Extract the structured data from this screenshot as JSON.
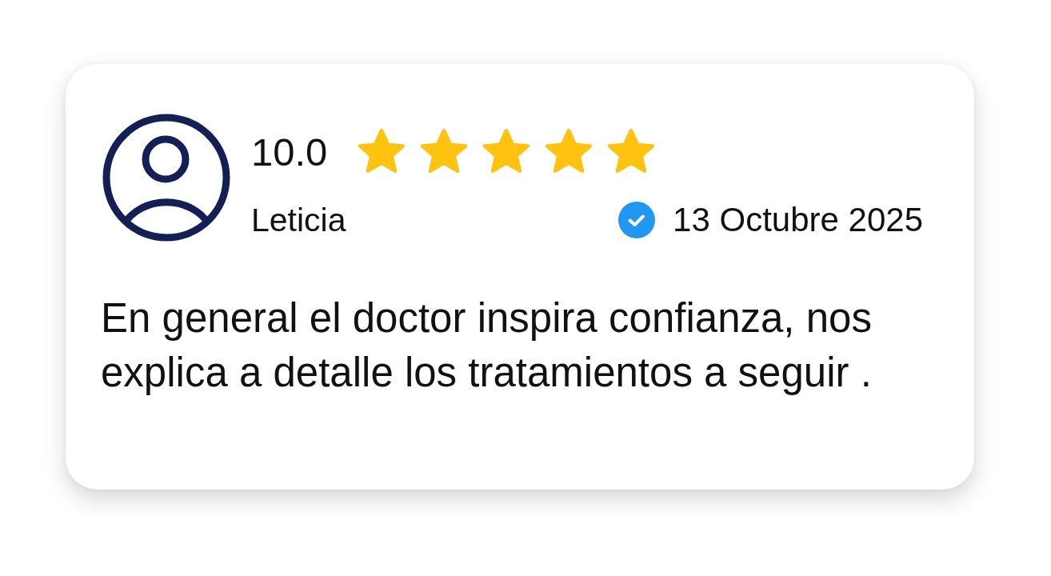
{
  "review": {
    "score": "10.0",
    "stars": 5,
    "author": "Leticia",
    "verified": true,
    "date": "13 Octubre 2025",
    "text": "En general el doctor inspira confianza, nos explica a detalle los tratamientos a seguir ."
  }
}
